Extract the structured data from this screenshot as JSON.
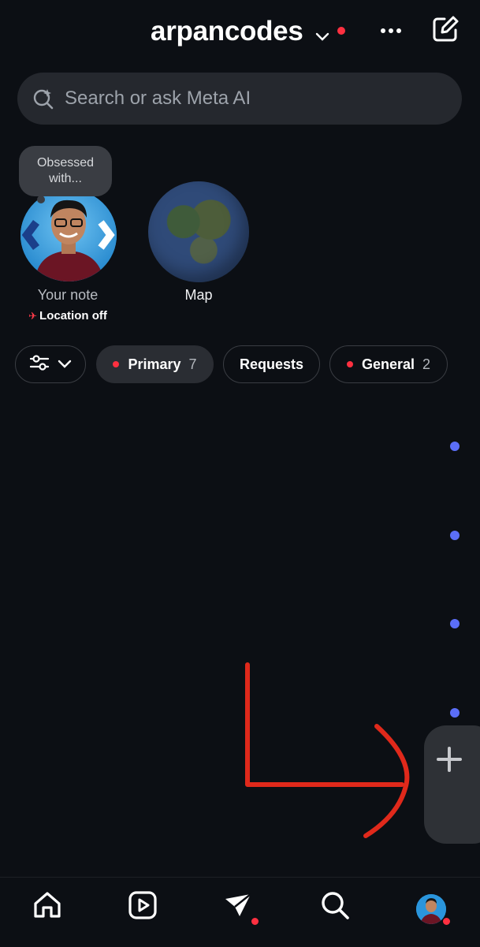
{
  "header": {
    "username": "arpancodes"
  },
  "search": {
    "placeholder": "Search or ask Meta AI"
  },
  "notes": {
    "bubble_text": "Obsessed with...",
    "your_note_label": "Your note",
    "location_label": "Location off",
    "map_label": "Map"
  },
  "filters": {
    "primary_label": "Primary",
    "primary_count": "7",
    "requests_label": "Requests",
    "general_label": "General",
    "general_count": "2"
  },
  "icons": {
    "header": [
      "chevron-down-icon",
      "more-icon",
      "new-message-icon"
    ],
    "search": "meta-ai-search-icon",
    "filter": [
      "sliders-icon",
      "chevron-down-icon"
    ],
    "fab": "plus-icon",
    "bottom_nav": [
      "home-icon",
      "reels-icon",
      "direct-icon",
      "search-icon",
      "profile-avatar"
    ]
  },
  "colors": {
    "background": "#0c0f14",
    "notification_red": "#ff3040",
    "unread_blue": "#5b6ef7",
    "annotation_red": "#e0291b"
  }
}
